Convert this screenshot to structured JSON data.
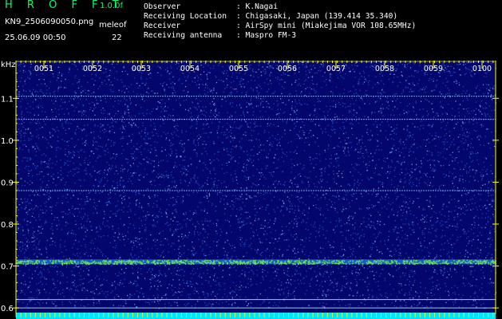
{
  "header": {
    "app_title": "H R O F F T",
    "app_version": "1.0.0f",
    "file_name": "KN9_2506090050.png",
    "datetime": "25.06.09 00:50",
    "site_label": "meleof",
    "site_count": "22",
    "info": [
      {
        "label": "Observer",
        "value": ": K.Nagai"
      },
      {
        "label": "Receiving Location",
        "value": ": Chigasaki, Japan (139.414 35.340)"
      },
      {
        "label": "Receiver",
        "value": ": AirSpy mini (Miakejima VOR 108.65MHz)"
      },
      {
        "label": "Receiving antenna",
        "value": ": Maspro FM-3"
      }
    ]
  },
  "chart_data": {
    "type": "heatmap",
    "ylabel": "kHz",
    "y_ticks": [
      "1.1",
      "1.0",
      "0.9",
      "0.8",
      "0.7",
      "0.6"
    ],
    "x_ticks": [
      "0051",
      "0052",
      "0053",
      "0054",
      "0055",
      "0056",
      "0057",
      "0058",
      "0059",
      "0100"
    ],
    "ylim": [
      0.585,
      1.19
    ],
    "signal_lines_khz": [
      1.105,
      1.05,
      0.88,
      0.71
    ],
    "colors": {
      "background": "#03066a",
      "noise": "#3b7cff",
      "signal": "#7fff3f",
      "axis": "#ffff00",
      "baseline": "#00e5ff"
    }
  }
}
